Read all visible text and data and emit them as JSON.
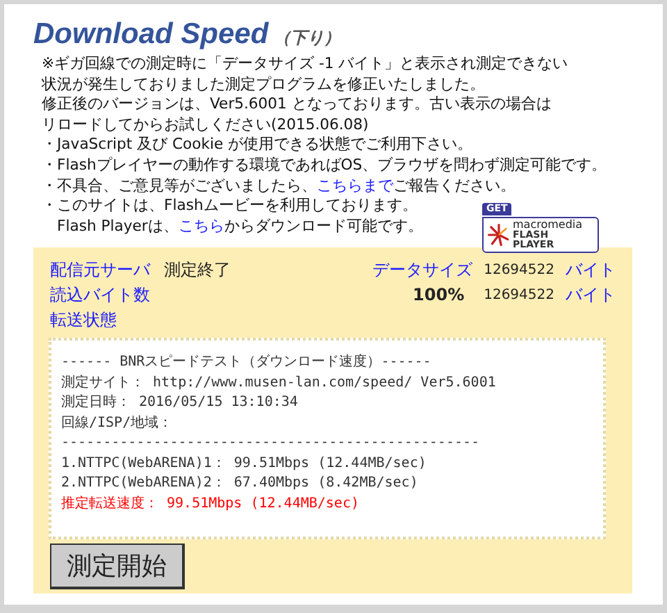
{
  "title": {
    "main": "Download Speed",
    "sub": "（下り）"
  },
  "notice": [
    [
      {
        "text": "※ギガ回線での測定時に「データサイズ -1 バイト」と表示され測定できない",
        "link": false
      }
    ],
    [
      {
        "text": "状況が発生しておりました測定プログラムを修正いたしました。",
        "link": false
      }
    ],
    [
      {
        "text": "修正後のバージョンは、Ver5.6001 となっております。古い表示の場合は",
        "link": false
      }
    ],
    [
      {
        "text": "リロードしてからお試しください(2015.06.08)",
        "link": false
      }
    ],
    [
      {
        "text": "・JavaScript 及び Cookie が使用できる状態でご利用下さい。",
        "link": false
      }
    ],
    [
      {
        "text": "・Flashプレイヤーの動作する環境であればOS、ブラウザを問わず測定可能です。",
        "link": false
      }
    ],
    [
      {
        "text": "・不具合、ご意見等がございましたら、",
        "link": false
      },
      {
        "text": "こちらまで",
        "link": true
      },
      {
        "text": "ご報告ください。",
        "link": false
      }
    ],
    [
      {
        "text": "・このサイトは、Flashムービーを利用しております。",
        "link": false
      }
    ],
    [
      {
        "text": "　Flash Playerは、",
        "link": false
      },
      {
        "text": "こちら",
        "link": true
      },
      {
        "text": "からダウンロード可能です。",
        "link": false
      }
    ]
  ],
  "flash_badge": {
    "get": "GET",
    "brand": "macromedia",
    "product": "FLASH PLAYER"
  },
  "stats": {
    "server_label": "配信元サーバ",
    "status": "測定終了",
    "data_size_label": "データサイズ",
    "data_size": "12694522",
    "data_size_unit": "バイト",
    "read_label": "読込バイト数",
    "percent": "100%",
    "read_bytes": "12694522",
    "read_unit": "バイト",
    "transfer_label": "転送状態"
  },
  "result": [
    {
      "kind": "text",
      "text": "------ BNRスピードテスト（ダウンロード速度）------"
    },
    {
      "kind": "text",
      "text": "測定サイト： http://www.musen-lan.com/speed/ Ver5.6001"
    },
    {
      "kind": "text",
      "text": "測定日時： 2016/05/15 13:10:34"
    },
    {
      "kind": "text",
      "text": "回線/ISP/地域："
    },
    {
      "kind": "text",
      "text": "--------------------------------------------------"
    },
    {
      "kind": "text",
      "text": "1.NTTPC(WebARENA)1： 99.51Mbps (12.44MB/sec)"
    },
    {
      "kind": "text",
      "text": "2.NTTPC(WebARENA)2： 67.40Mbps (8.42MB/sec)"
    },
    {
      "kind": "highlight",
      "text": "推定転送速度： 99.51Mbps (12.44MB/sec)"
    }
  ],
  "start_button": "測定開始"
}
